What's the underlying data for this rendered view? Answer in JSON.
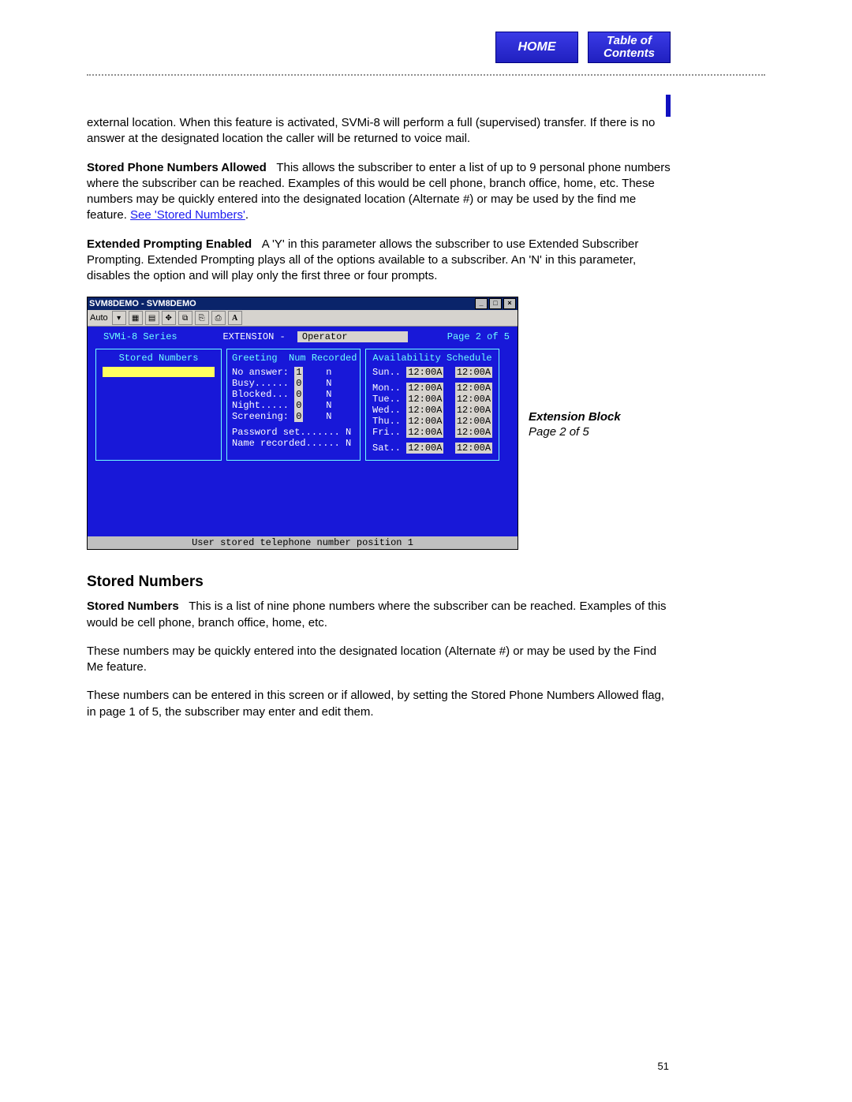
{
  "nav": {
    "home": "HOME",
    "toc1": "Table of",
    "toc2": "Contents"
  },
  "para_intro": "external location. When this feature is activated, SVMi-8 will perform a full (supervised) transfer. If there is no answer at the designated location the caller will be returned to voice mail.",
  "stored_allowed": {
    "lead": "Stored Phone Numbers Allowed",
    "body1": "This allows the subscriber to enter a list of up to 9 personal phone numbers where the subscriber can be reached. Examples of this would be cell phone, branch office, home, etc. These numbers may be quickly entered into the designated location (Alternate #) or may be used by the find me feature. ",
    "link": "See 'Stored Numbers'",
    "body2": "."
  },
  "ext_prompt": {
    "lead": "Extended Prompting Enabled",
    "body": "A 'Y' in this parameter allows the subscriber to use Extended Subscriber Prompting. Extended Prompting plays all of the options available to a subscriber.  An 'N' in this parameter, disables the option and will play only the first three or four prompts."
  },
  "terminal": {
    "title": "SVM8DEMO - SVM8DEMO",
    "toolbar_auto": "Auto",
    "series": "SVMi-8 Series",
    "ext_label": "EXTENSION  -",
    "ext_value": "Operator",
    "page": "Page 2 of 5",
    "stored_title": "Stored Numbers",
    "greet_title": "Greeting  Num Recorded",
    "greet": [
      {
        "label": "No answer:",
        "num": "1",
        "rec": "n"
      },
      {
        "label": "Busy......",
        "num": "0",
        "rec": "N"
      },
      {
        "label": "Blocked...",
        "num": "0",
        "rec": "N"
      },
      {
        "label": "Night.....",
        "num": "0",
        "rec": "N"
      },
      {
        "label": "Screening:",
        "num": "0",
        "rec": "N"
      }
    ],
    "pw_set": "Password set....... N",
    "name_rec": "Name recorded...... N",
    "sched_title": "Availability Schedule",
    "sched": [
      {
        "d": "Sun..",
        "a": "12:00A",
        "b": "12:00A",
        "gap": true
      },
      {
        "d": "Mon..",
        "a": "12:00A",
        "b": "12:00A"
      },
      {
        "d": "Tue..",
        "a": "12:00A",
        "b": "12:00A"
      },
      {
        "d": "Wed..",
        "a": "12:00A",
        "b": "12:00A"
      },
      {
        "d": "Thu..",
        "a": "12:00A",
        "b": "12:00A"
      },
      {
        "d": "Fri..",
        "a": "12:00A",
        "b": "12:00A",
        "gap": true
      },
      {
        "d": "Sat..",
        "a": "12:00A",
        "b": "12:00A"
      }
    ],
    "footer": "User stored telephone number position 1"
  },
  "beside": {
    "t1": "Extension Block",
    "t2": "Page 2 of 5"
  },
  "section_title": "Stored Numbers",
  "sn": {
    "lead": "Stored Numbers",
    "p1": "This is a list of nine phone numbers where the subscriber can be reached. Examples of this would be cell phone, branch office, home, etc.",
    "p2": "These numbers may be quickly entered into the designated location (Alternate #) or may be used by the Find Me feature.",
    "p3": "These numbers can be entered in this screen or if allowed, by setting the Stored Phone Numbers Allowed flag, in page 1 of 5, the subscriber may enter and edit them."
  },
  "page_num": "51"
}
